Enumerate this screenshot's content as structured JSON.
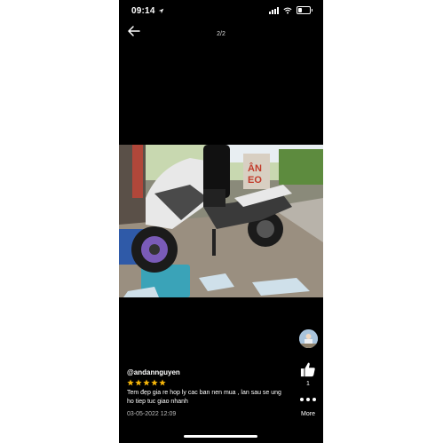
{
  "status_bar": {
    "time": "09:14"
  },
  "viewer": {
    "page_indicator": "2/2"
  },
  "review": {
    "username": "@andannguyen",
    "rating": 5,
    "text": "Tem đẹp gia re hop ly cac ban nen mua , lan sau se ung ho tiep tuc giao nhanh",
    "date": "03-05-2022 12:09"
  },
  "actions": {
    "like_count": "1",
    "more_label": "More"
  },
  "icons": [
    "back-arrow-icon",
    "location-arrow-icon",
    "signal-icon",
    "wifi-icon",
    "battery-icon",
    "thumbs-up-icon",
    "more-icon",
    "star-icon"
  ],
  "colors": {
    "background": "#000000",
    "star": "#f5b50a",
    "text": "#ffffff"
  }
}
